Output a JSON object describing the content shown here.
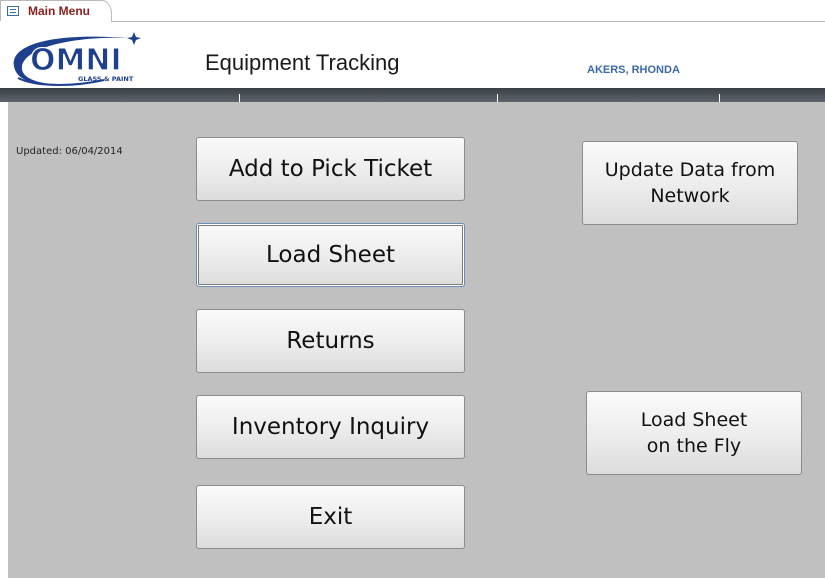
{
  "tab": {
    "label": "Main Menu",
    "icon": "form-icon"
  },
  "header": {
    "title": "Equipment Tracking",
    "user": "AKERS, RHONDA",
    "logo_text": "OMNI",
    "logo_subtext": "GLASS & PAINT"
  },
  "form": {
    "updated_label": "Updated: 06/04/2014",
    "buttons": {
      "add_pick_ticket": "Add to Pick Ticket",
      "load_sheet": "Load Sheet",
      "returns": "Returns",
      "inventory_inquiry": "Inventory Inquiry",
      "exit": "Exit",
      "update_data": "Update Data from\nNetwork",
      "load_sheet_fly": "Load Sheet\non the Fly"
    }
  },
  "colors": {
    "form_background": "#c0c0c0",
    "header_bar": "#4a5157",
    "user_text": "#3b6aa8",
    "logo_blue": "#1f3f8f"
  }
}
